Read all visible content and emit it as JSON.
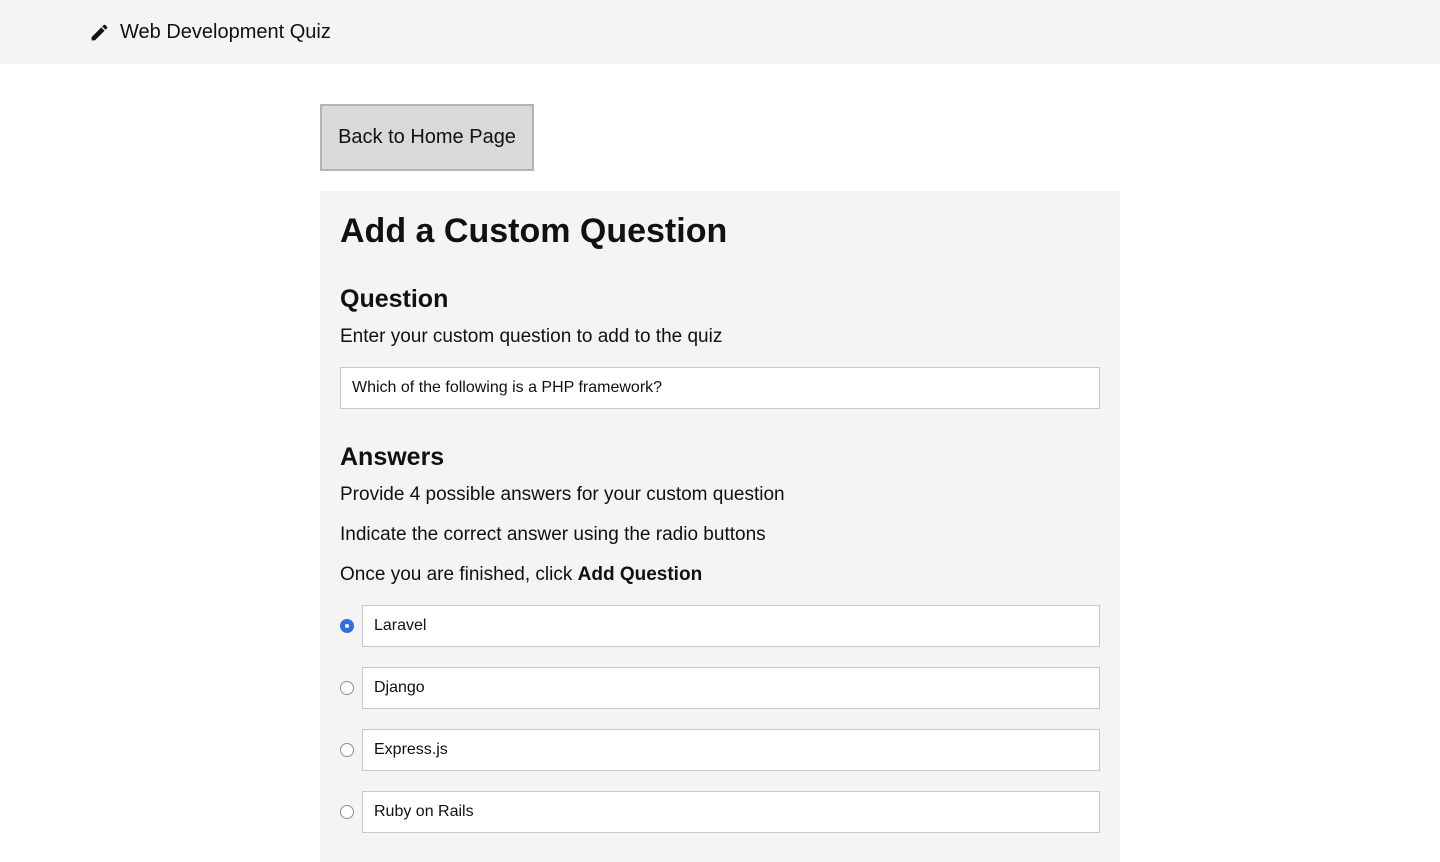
{
  "header": {
    "title": "Web Development Quiz",
    "icon": "pencil-icon"
  },
  "back_button": {
    "label": "Back to Home Page"
  },
  "form": {
    "title": "Add a Custom Question",
    "question_section": {
      "heading": "Question",
      "instruction": "Enter your custom question to add to the quiz",
      "value": "Which of the following is a PHP framework?"
    },
    "answers_section": {
      "heading": "Answers",
      "instruction_1": "Provide 4 possible answers for your custom question",
      "instruction_2": "Indicate the correct answer using the radio buttons",
      "instruction_3_prefix": "Once you are finished, click ",
      "instruction_3_bold": "Add Question",
      "answers": [
        {
          "value": "Laravel",
          "correct": true
        },
        {
          "value": "Django",
          "correct": false
        },
        {
          "value": "Express.js",
          "correct": false
        },
        {
          "value": "Ruby on Rails",
          "correct": false
        }
      ]
    }
  },
  "colors": {
    "topbar_bg": "#f4f4f4",
    "panel_bg": "#f4f4f4",
    "button_bg": "#d9d9d9",
    "radio_checked": "#2f6fe4"
  }
}
